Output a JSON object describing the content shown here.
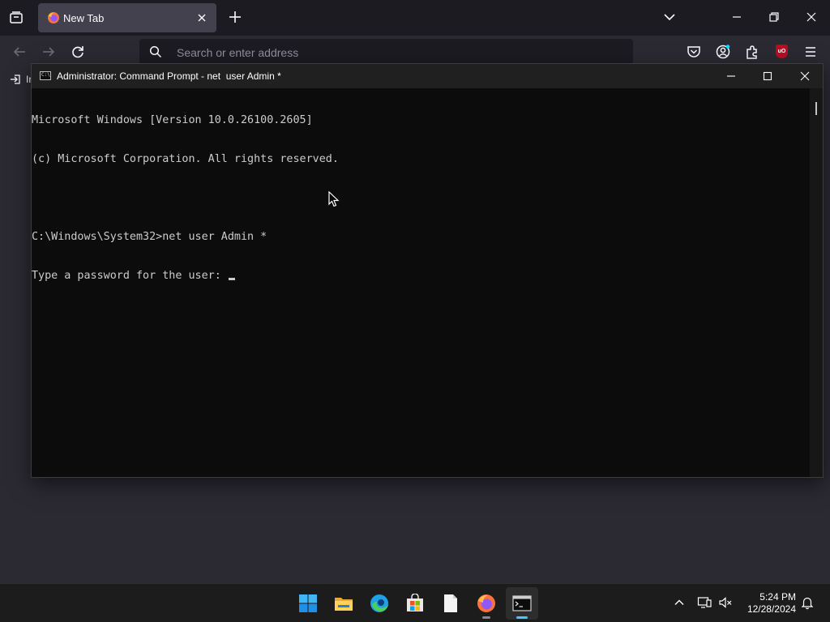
{
  "browser": {
    "tab_title": "New Tab",
    "url_placeholder": "Search or enter address",
    "bookmark_import_label": "Ir",
    "ublock_badge_text": "uO"
  },
  "cmd": {
    "title": "Administrator: Command Prompt - net  user Admin *",
    "icon_text": "C:\\",
    "lines": [
      "Microsoft Windows [Version 10.0.26100.2605]",
      "(c) Microsoft Corporation. All rights reserved.",
      "",
      "C:\\Windows\\System32>net user Admin *",
      "Type a password for the user: "
    ]
  },
  "taskbar": {
    "time": "5:24 PM",
    "date": "12/28/2024",
    "apps": [
      "start",
      "file-explorer",
      "edge",
      "microsoft-store",
      "notepad",
      "firefox",
      "command-prompt"
    ]
  },
  "colors": {
    "firefox_tabbar": "#1c1b22",
    "firefox_toolbar": "#2b2a33",
    "console_bg": "#0c0c0c",
    "console_text": "#cccccc",
    "taskbar_bg": "#1c1c1c",
    "active_indicator": "#4cc2ff"
  }
}
